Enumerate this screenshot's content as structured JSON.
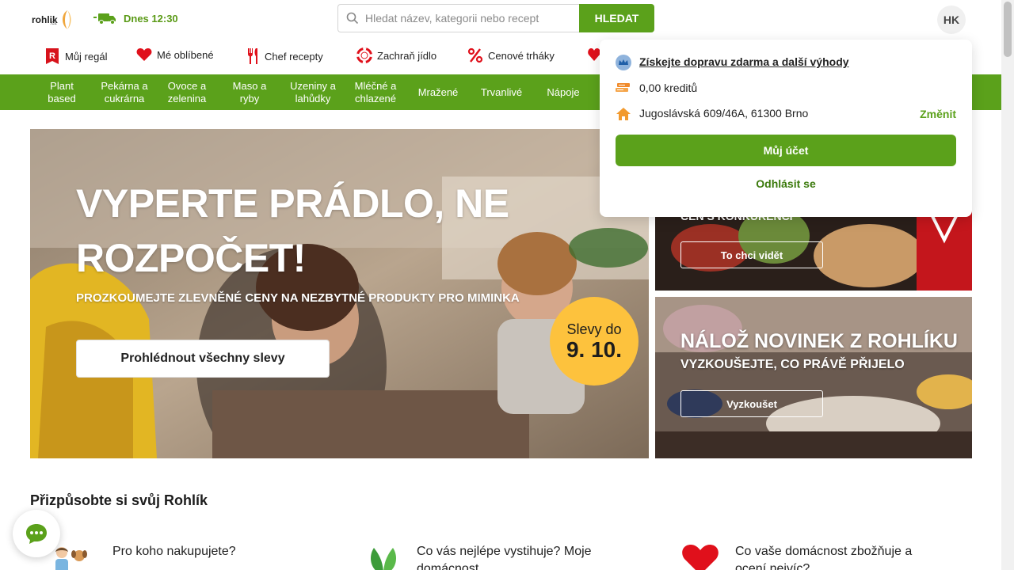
{
  "header": {
    "logo_text": "rohlik",
    "logo_sub": ".cz",
    "delivery_label": "Dnes 12:30",
    "search_placeholder": "Hledat název, kategorii nebo recept",
    "search_button": "HLEDAT",
    "avatar_initials": "HK"
  },
  "secondary_nav": [
    {
      "label": "Můj regál",
      "icon": "shelf-r-icon"
    },
    {
      "label": "Mé oblíbené",
      "icon": "heart-icon"
    },
    {
      "label": "Chef recepty",
      "icon": "cutlery-icon"
    },
    {
      "label": "Zachraň jídlo",
      "icon": "lifebuoy-icon"
    },
    {
      "label": "Cenové trháky",
      "icon": "percent-icon"
    }
  ],
  "categories": [
    {
      "line1": "Plant",
      "line2": "based"
    },
    {
      "line1": "Pekárna a",
      "line2": "cukrárna"
    },
    {
      "line1": "Ovoce a",
      "line2": "zelenina"
    },
    {
      "line1": "Maso a",
      "line2": "ryby"
    },
    {
      "line1": "Uzeniny a",
      "line2": "lahůdky"
    },
    {
      "line1": "Mléčné a",
      "line2": "chlazené"
    },
    {
      "line1": "Mražené",
      "line2": ""
    },
    {
      "line1": "Trvanlivé",
      "line2": ""
    },
    {
      "line1": "Nápoje",
      "line2": ""
    }
  ],
  "hero": {
    "title_line1": "VYPERTE PRÁDLO, NE",
    "title_line2": "ROZPOČET!",
    "subtitle": "PROZKOUMEJTE ZLEVNĚNÉ CENY NA NEZBYTNÉ PRODUKTY PRO MIMINKA",
    "button": "Prohlédnout všechny slevy",
    "badge_line1": "Slevy do",
    "badge_line2": "9. 10."
  },
  "promo1": {
    "text": "CEN S KONKURENCÍ",
    "button": "To chci vidět"
  },
  "promo2": {
    "title": "NÁLOŽ NOVINEK Z ROHLÍKU",
    "subtitle": "VYZKOUŠEJTE, CO PRÁVĚ PŘIJELO",
    "button": "Vyzkoušet"
  },
  "account_dropdown": {
    "benefits_link": "Získejte dopravu zdarma a další výhody",
    "credits": "0,00 kreditů",
    "address": "Jugoslávská 609/46A, 61300 Brno",
    "change": "Změnit",
    "account_button": "Můj účet",
    "logout": "Odhlásit se"
  },
  "customize": {
    "title": "Přizpůsobte si svůj Rohlík",
    "cards": [
      {
        "line1": "Pro koho nakupujete?",
        "line2": ""
      },
      {
        "line1": "Co vás nejlépe vystihuje? Moje",
        "line2": "domácnost..."
      },
      {
        "line1": "Co vaše domácnost zbožňuje a",
        "line2": "ocení nejvíc?"
      }
    ]
  },
  "colors": {
    "brand_green": "#5ba11b",
    "badge_yellow": "#fdc23d",
    "heart_red": "#e0101b"
  }
}
